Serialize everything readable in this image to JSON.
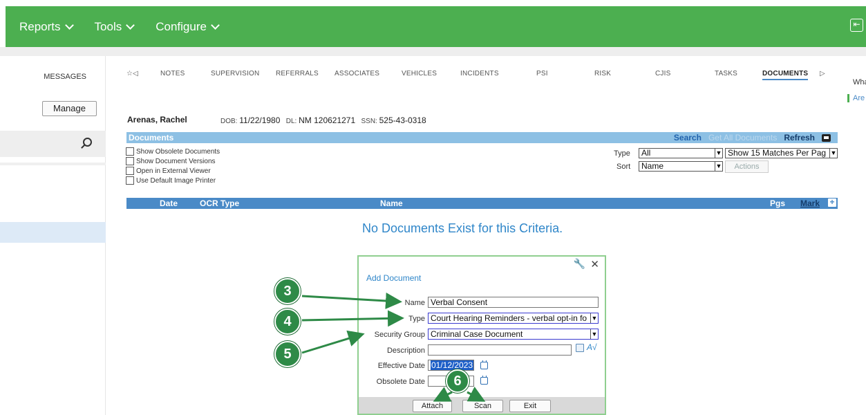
{
  "topnav": {
    "items": [
      {
        "label": "Reports"
      },
      {
        "label": "Tools"
      },
      {
        "label": "Configure"
      }
    ],
    "exit_icon": "exit-icon"
  },
  "left": {
    "messages": "MESSAGES",
    "manage": "Manage"
  },
  "right": {
    "what": "Wha",
    "are": "Are"
  },
  "tabs": [
    "NOTES",
    "SUPERVISION",
    "REFERRALS",
    "ASSOCIATES",
    "VEHICLES",
    "INCIDENTS",
    "PSI",
    "RISK",
    "CJIS",
    "TASKS",
    "DOCUMENTS"
  ],
  "tab_active": "DOCUMENTS",
  "person": {
    "name": "Arenas, Rachel",
    "dob_label": "DOB:",
    "dob": "11/22/1980",
    "dl_label": "DL:",
    "dl": "NM 120621271",
    "ssn_label": "SSN:",
    "ssn": "525-43-0318"
  },
  "documents": {
    "title": "Documents",
    "search": "Search",
    "get_all": "Get All Documents",
    "refresh": "Refresh",
    "options": [
      "Show Obsolete Documents",
      "Show Document Versions",
      "Open in External Viewer",
      "Use Default Image Printer"
    ],
    "type_label": "Type",
    "type_value": "All",
    "sort_label": "Sort",
    "sort_value": "Name",
    "matches_value": "Show 15 Matches Per Pag",
    "actions": "Actions",
    "columns": {
      "date": "Date",
      "ocr": "OCR",
      "type": "Type",
      "name": "Name",
      "pgs": "Pgs",
      "mark": "Mark"
    },
    "empty_message": "No Documents Exist for this Criteria."
  },
  "dialog": {
    "title": "Add Document",
    "fields": {
      "name_label": "Name",
      "name_value": "Verbal Consent",
      "type_label": "Type",
      "type_value": "Court Hearing Reminders - verbal opt-in fo",
      "security_label": "Security Group",
      "security_value": "Criminal Case Document",
      "description_label": "Description",
      "description_value": "",
      "effective_label": "Effective Date",
      "effective_value": "01/12/2023",
      "obsolete_label": "Obsolete Date",
      "obsolete_value": ""
    },
    "buttons": {
      "attach": "Attach",
      "scan": "Scan",
      "exit": "Exit"
    }
  },
  "callouts": [
    "3",
    "4",
    "5",
    "6"
  ],
  "colors": {
    "topbar": "#4caf50",
    "header_blue": "#4a8ac7",
    "light_blue": "#8dc0e4",
    "callout_green": "#2e8a47"
  }
}
